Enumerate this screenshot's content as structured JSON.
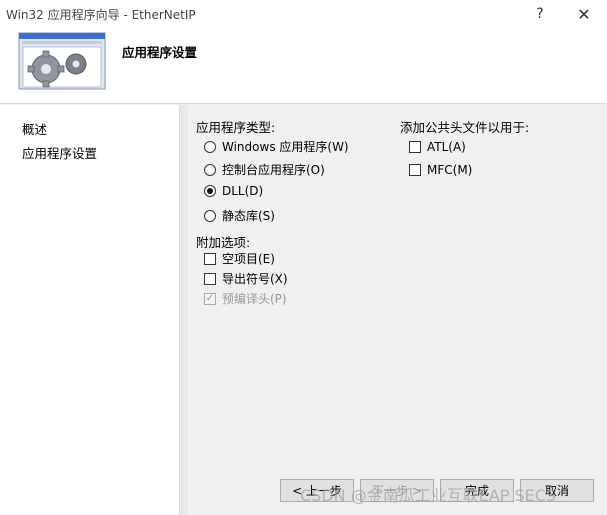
{
  "window": {
    "title": "Win32 应用程序向导 - EtherNetIP",
    "help_glyph": "?",
    "close_glyph": "✕"
  },
  "header": {
    "title": "应用程序设置",
    "image_icon": "gears-icon"
  },
  "nav": {
    "items": [
      {
        "label": "概述"
      },
      {
        "label": "应用程序设置"
      }
    ]
  },
  "app_type": {
    "heading": "应用程序类型:",
    "options": [
      {
        "label": "Windows 应用程序(W)",
        "checked": false
      },
      {
        "label": "控制台应用程序(O)",
        "checked": false
      },
      {
        "label": "DLL(D)",
        "checked": true
      },
      {
        "label": "静态库(S)",
        "checked": false
      }
    ]
  },
  "extra_options": {
    "heading": "附加选项:",
    "items": [
      {
        "label": "空项目(E)",
        "checked": false,
        "disabled": false
      },
      {
        "label": "导出符号(X)",
        "checked": false,
        "disabled": false
      },
      {
        "label": "预编译头(P)",
        "checked": true,
        "disabled": true
      }
    ]
  },
  "common_headers": {
    "heading": "添加公共头文件以用于:",
    "items": [
      {
        "label": "ATL(A)",
        "checked": false
      },
      {
        "label": "MFC(M)",
        "checked": false
      }
    ]
  },
  "buttons": {
    "back": "< 上一步",
    "next": "下一步 >",
    "finish": "完成",
    "cancel": "取消"
  },
  "watermark": "CSDN @金南瓜工业互联EAP SECS"
}
